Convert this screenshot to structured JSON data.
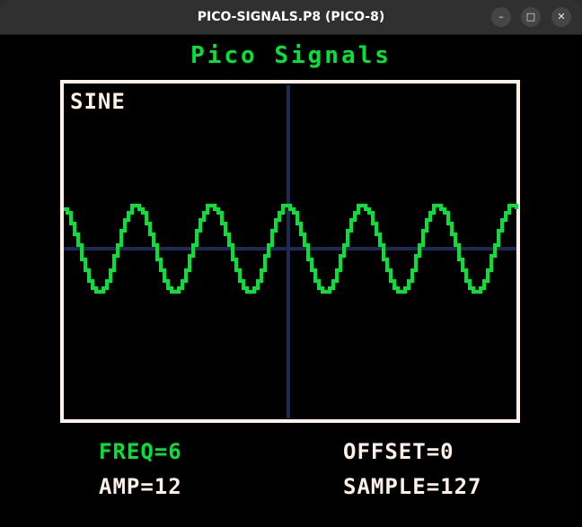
{
  "window": {
    "title": "PICO-SIGNALS.P8 (PICO-8)",
    "buttons": {
      "minimize": "–",
      "maximize": "□",
      "close": "✕"
    }
  },
  "game": {
    "title": "Pico Signals",
    "waveform": "SINE",
    "stats": {
      "freq": "FREQ=6",
      "amp": "AMP=12",
      "offset": "OFFSET=0",
      "sample": "SAMPLE=127"
    }
  },
  "colors": {
    "wave": "#00e436",
    "frame": "#fff1e8",
    "axis": "#1d2b53",
    "text": "#fff1e8",
    "highlight": "#00e436",
    "background": "#000000"
  },
  "chart_data": {
    "type": "line",
    "waveform": "sine",
    "frequency": 6,
    "amplitude": 12,
    "offset": 0,
    "sample": 127,
    "x_axis_visible": true,
    "y_axis_visible": true
  }
}
